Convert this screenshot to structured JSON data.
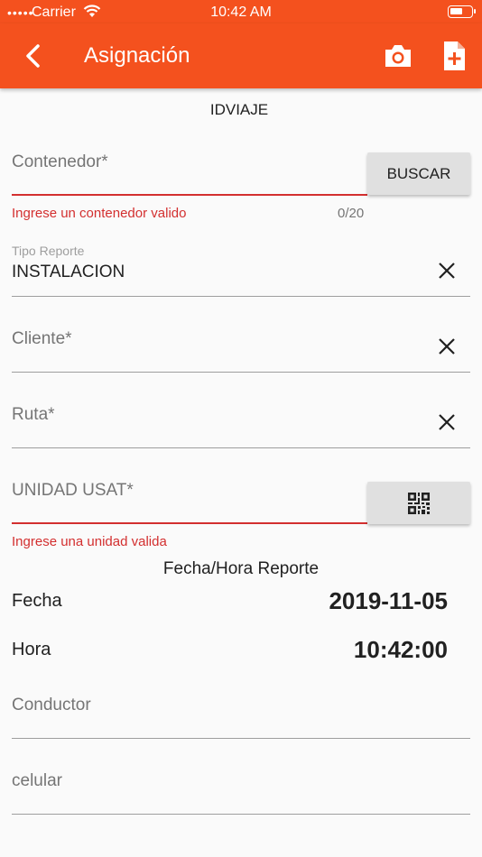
{
  "status_bar": {
    "signal": "•••••",
    "carrier": "Carrier",
    "time": "10:42 AM"
  },
  "app_bar": {
    "title": "Asignación",
    "accent": "#f4511e"
  },
  "idviaje": "IDVIAJE",
  "contenedor": {
    "placeholder": "Contenedor*",
    "button": "BUSCAR",
    "error": "Ingrese un contenedor valido",
    "counter": "0/20"
  },
  "tipo_reporte": {
    "label": "Tipo Reporte",
    "value": "INSTALACION"
  },
  "cliente": {
    "placeholder": "Cliente*"
  },
  "ruta": {
    "placeholder": "Ruta*"
  },
  "unidad": {
    "placeholder": "UNIDAD USAT*",
    "error": "Ingrese una unidad valida"
  },
  "fecha_hora": {
    "title": "Fecha/Hora Reporte",
    "fecha_label": "Fecha",
    "fecha_value": "2019-11-05",
    "hora_label": "Hora",
    "hora_value": "10:42:00"
  },
  "conductor": {
    "placeholder": "Conductor"
  },
  "celular": {
    "placeholder": "celular"
  },
  "icons": [
    "signal-icon",
    "wifi-icon",
    "battery-icon",
    "back-icon",
    "camera-icon",
    "add-document-icon",
    "clear-icon",
    "qr-code-icon"
  ]
}
